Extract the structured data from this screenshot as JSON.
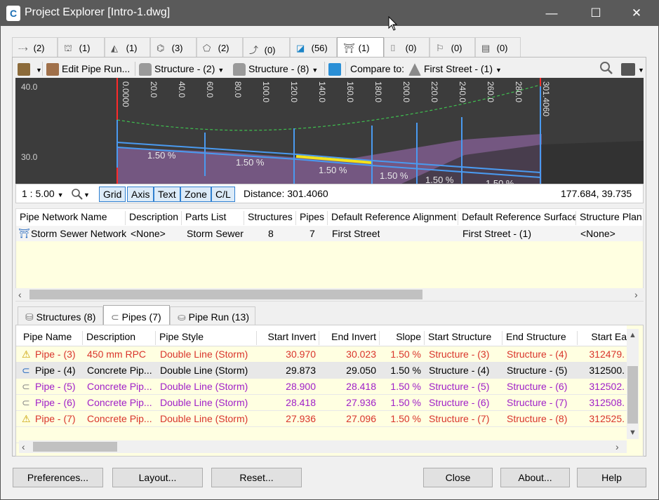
{
  "window": {
    "title": "Project Explorer [Intro-1.dwg]",
    "app_icon_letter": "C",
    "minimize": "—",
    "maximize": "☐",
    "close": "✕"
  },
  "tabs": [
    {
      "icon": "alignment-icon",
      "glyph": "⤏",
      "count": "(2)"
    },
    {
      "icon": "corridor-icon",
      "glyph": "⛫",
      "count": "(1)"
    },
    {
      "icon": "profile-icon",
      "glyph": "◭",
      "count": "(1)"
    },
    {
      "icon": "assembly-icon",
      "glyph": "⌬",
      "count": "(3)"
    },
    {
      "icon": "surface-icon",
      "glyph": "⬠",
      "count": "(2)"
    },
    {
      "icon": "sample-line-icon",
      "glyph": "⤴",
      "count": "(0)"
    },
    {
      "icon": "section-icon",
      "glyph": "◪",
      "count": "(56)"
    },
    {
      "icon": "pipe-network-icon",
      "glyph": "⛩",
      "count": "(1)"
    },
    {
      "icon": "pressure-network-icon",
      "glyph": "⌷",
      "count": "(0)"
    },
    {
      "icon": "parcel-icon",
      "glyph": "⚐",
      "count": "(0)"
    },
    {
      "icon": "sheet-icon",
      "glyph": "▤",
      "count": "(0)"
    }
  ],
  "toolbar": {
    "edit_pipe_run": "Edit Pipe Run...",
    "structure_a": "Structure - (2)",
    "structure_b": "Structure - (8)",
    "compare_to_label": "Compare to:",
    "compare_to_value": "First Street - (1)"
  },
  "profile_view": {
    "y_labels": [
      "40.0",
      "30.0"
    ],
    "stations": [
      "0.0000",
      "20.0",
      "40.0",
      "60.0",
      "80.0",
      "100.0",
      "120.0",
      "140.0",
      "160.0",
      "180.0",
      "200.0",
      "220.0",
      "240.0",
      "260.0",
      "280.0",
      "301.4060"
    ],
    "slope_labels": [
      "1.50 %",
      "1.50 %",
      "1.50 %",
      "1.50 %",
      "1.50 %",
      "1.50 %"
    ]
  },
  "statusbar": {
    "scale": "1 : 5.00",
    "grid": "Grid",
    "axis": "Axis",
    "text": "Text",
    "zone": "Zone",
    "cl": "C/L",
    "distance": "Distance: 301.4060",
    "coords": "177.684, 39.735"
  },
  "network_table": {
    "headers": [
      "Pipe Network Name",
      "Description",
      "Parts List",
      "Structures",
      "Pipes",
      "Default Reference Alignment",
      "Default Reference Surface",
      "Structure Plan L"
    ],
    "row": [
      "Storm Sewer Network",
      "<None>",
      "Storm Sewer",
      "8",
      "7",
      "First Street",
      "First Street - (1)",
      "<None>"
    ]
  },
  "subtabs": [
    {
      "label": "Structures (8)",
      "icon": "structure-icon"
    },
    {
      "label": "Pipes (7)",
      "icon": "pipe-icon"
    },
    {
      "label": "Pipe Run (13)",
      "icon": "pipe-run-icon"
    }
  ],
  "pipes_table": {
    "headers": [
      "Pipe Name",
      "Description",
      "Pipe Style",
      "Start Invert",
      "End Invert",
      "Slope",
      "Start Structure",
      "End Structure",
      "Start Ea"
    ],
    "rows": [
      {
        "icon": "pipe-warning-icon",
        "color": "#d9342b",
        "cells": [
          "Pipe - (3)",
          "450 mm RPC",
          "Double Line (Storm)",
          "30.970",
          "30.023",
          "1.50 %",
          "Structure - (3)",
          "Structure - (4)",
          "312479."
        ]
      },
      {
        "icon": "pipe-selected-icon",
        "color": "#000000",
        "cells": [
          "Pipe - (4)",
          "Concrete Pip...",
          "Double Line (Storm)",
          "29.873",
          "29.050",
          "1.50 %",
          "Structure - (4)",
          "Structure - (5)",
          "312500."
        ]
      },
      {
        "icon": "pipe-icon",
        "color": "#a020c8",
        "cells": [
          "Pipe - (5)",
          "Concrete Pip...",
          "Double Line (Storm)",
          "28.900",
          "28.418",
          "1.50 %",
          "Structure - (5)",
          "Structure - (6)",
          "312502."
        ]
      },
      {
        "icon": "pipe-icon",
        "color": "#a020c8",
        "cells": [
          "Pipe - (6)",
          "Concrete Pip...",
          "Double Line (Storm)",
          "28.418",
          "27.936",
          "1.50 %",
          "Structure - (6)",
          "Structure - (7)",
          "312508."
        ]
      },
      {
        "icon": "pipe-warning-icon",
        "color": "#d9342b",
        "cells": [
          "Pipe - (7)",
          "Concrete Pip...",
          "Double Line (Storm)",
          "27.936",
          "27.096",
          "1.50 %",
          "Structure - (7)",
          "Structure - (8)",
          "312525."
        ]
      }
    ]
  },
  "buttons": {
    "preferences": "Preferences...",
    "layout": "Layout...",
    "reset": "Reset...",
    "close": "Close",
    "about": "About...",
    "help": "Help"
  }
}
